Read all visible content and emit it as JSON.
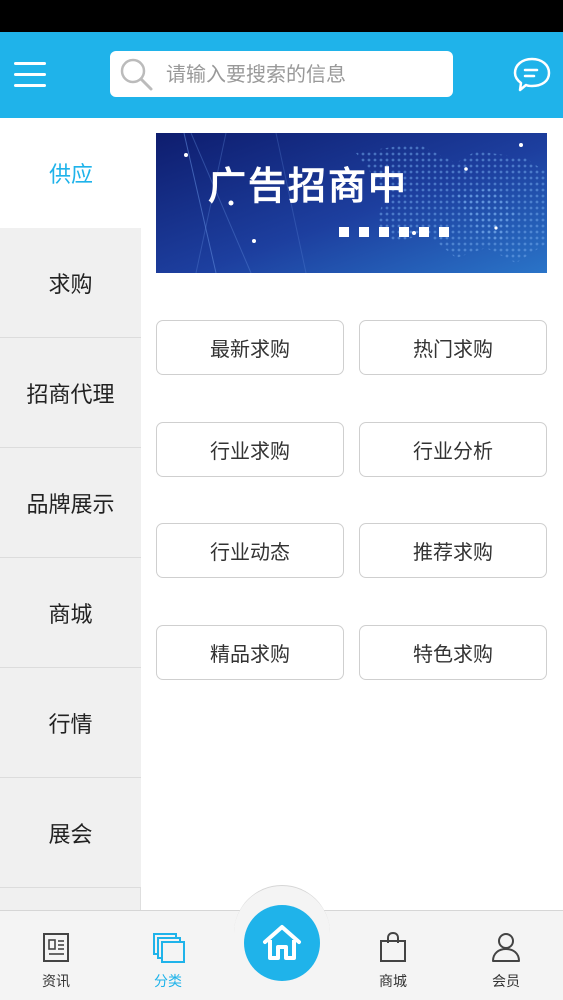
{
  "header": {
    "search": {
      "placeholder": "请输入要搜索的信息"
    }
  },
  "sidebar": {
    "items": [
      {
        "label": "供应",
        "active": true
      },
      {
        "label": "求购"
      },
      {
        "label": "招商代理"
      },
      {
        "label": "品牌展示"
      },
      {
        "label": "商城"
      },
      {
        "label": "行情"
      },
      {
        "label": "展会"
      }
    ]
  },
  "banner": {
    "text": "广告招商中"
  },
  "categories": [
    "最新求购",
    "热门求购",
    "行业求购",
    "行业分析",
    "行业动态",
    "推荐求购",
    "精品求购",
    "特色求购"
  ],
  "tabbar": {
    "tabs": [
      {
        "label": "资讯",
        "icon": "news-icon"
      },
      {
        "label": "分类",
        "icon": "category-icon",
        "active": true
      },
      {
        "label": "商城",
        "icon": "shopping-bag-icon"
      },
      {
        "label": "会员",
        "icon": "user-icon"
      }
    ],
    "home_icon": "home-icon"
  },
  "colors": {
    "accent": "#1fb3ea",
    "sidebar_bg": "#f0f0f0",
    "text": "#333333"
  }
}
